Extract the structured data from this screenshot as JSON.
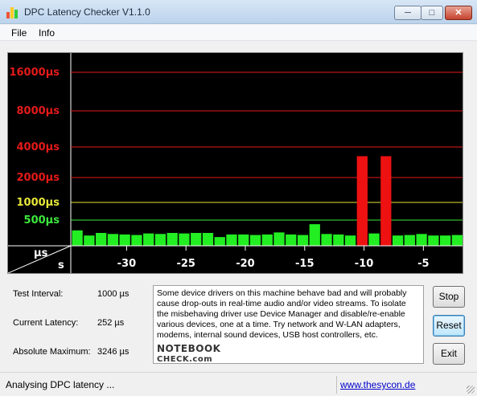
{
  "window": {
    "title": "DPC Latency Checker V1.1.0",
    "minimize": "─",
    "maximize": "□",
    "close": "✕",
    "icon": "bar-chart-icon"
  },
  "menu": [
    {
      "label": "File"
    },
    {
      "label": "Info"
    }
  ],
  "chart_data": {
    "type": "bar",
    "y_levels": [
      {
        "label": "16000µs",
        "value": 16000,
        "color": "#e41a1a"
      },
      {
        "label": "8000µs",
        "value": 8000,
        "color": "#e41a1a"
      },
      {
        "label": "4000µs",
        "value": 4000,
        "color": "#e41a1a"
      },
      {
        "label": "2000µs",
        "value": 2000,
        "color": "#e41a1a"
      },
      {
        "label": "1000µs",
        "value": 1000,
        "color": "#e6e63a"
      },
      {
        "label": "500µs",
        "value": 500,
        "color": "#3ce83c"
      }
    ],
    "axis_corner_top": "µs",
    "axis_corner_bottom": "s",
    "x_ticks": [
      -30,
      -25,
      -20,
      -15,
      -10,
      -5
    ],
    "x_tick_labels": [
      "-30",
      "-25",
      "-20",
      "-15",
      "-10",
      "-5"
    ],
    "x_range": [
      -34,
      -1
    ],
    "bars": [
      {
        "x": -34,
        "value": 300
      },
      {
        "x": -33,
        "value": 200
      },
      {
        "x": -32,
        "value": 250
      },
      {
        "x": -31,
        "value": 230
      },
      {
        "x": -30,
        "value": 220
      },
      {
        "x": -29,
        "value": 210
      },
      {
        "x": -28,
        "value": 240
      },
      {
        "x": -27,
        "value": 230
      },
      {
        "x": -26,
        "value": 250
      },
      {
        "x": -25,
        "value": 240
      },
      {
        "x": -24,
        "value": 250
      },
      {
        "x": -23,
        "value": 250
      },
      {
        "x": -22,
        "value": 170
      },
      {
        "x": -21,
        "value": 220
      },
      {
        "x": -20,
        "value": 220
      },
      {
        "x": -19,
        "value": 210
      },
      {
        "x": -18,
        "value": 220
      },
      {
        "x": -17,
        "value": 260
      },
      {
        "x": -16,
        "value": 220
      },
      {
        "x": -15,
        "value": 210
      },
      {
        "x": -14,
        "value": 420
      },
      {
        "x": -13,
        "value": 230
      },
      {
        "x": -12,
        "value": 220
      },
      {
        "x": -11,
        "value": 200
      },
      {
        "x": -10,
        "value": 3246
      },
      {
        "x": -9,
        "value": 240
      },
      {
        "x": -8,
        "value": 3246
      },
      {
        "x": -7,
        "value": 200
      },
      {
        "x": -6,
        "value": 210
      },
      {
        "x": -5,
        "value": 230
      },
      {
        "x": -4,
        "value": 200
      },
      {
        "x": -3,
        "value": 200
      },
      {
        "x": -2,
        "value": 210
      }
    ],
    "bar_color_ok": "#22ee22",
    "bar_color_bad": "#ee1111",
    "threshold_bad": 2000
  },
  "info": {
    "test_interval_label": "Test Interval:",
    "test_interval_value": "1000 µs",
    "current_latency_label": "Current Latency:",
    "current_latency_value": "252 µs",
    "absolute_max_label": "Absolute Maximum:",
    "absolute_max_value": "3246 µs"
  },
  "message": "Some device drivers on this machine behave bad and will probably cause drop-outs in real-time audio and/or video streams. To isolate the misbehaving driver use Device Manager and disable/re-enable various devices, one at a time. Try network and W-LAN adapters, modems, internal sound devices, USB host controllers, etc.",
  "logo": {
    "line1": "NOTEBOOK",
    "line2": "CHECK.com"
  },
  "buttons": {
    "stop": "Stop",
    "reset": "Reset",
    "exit": "Exit"
  },
  "status": {
    "text": "Analysing DPC latency ...",
    "link": "www.thesycon.de"
  }
}
